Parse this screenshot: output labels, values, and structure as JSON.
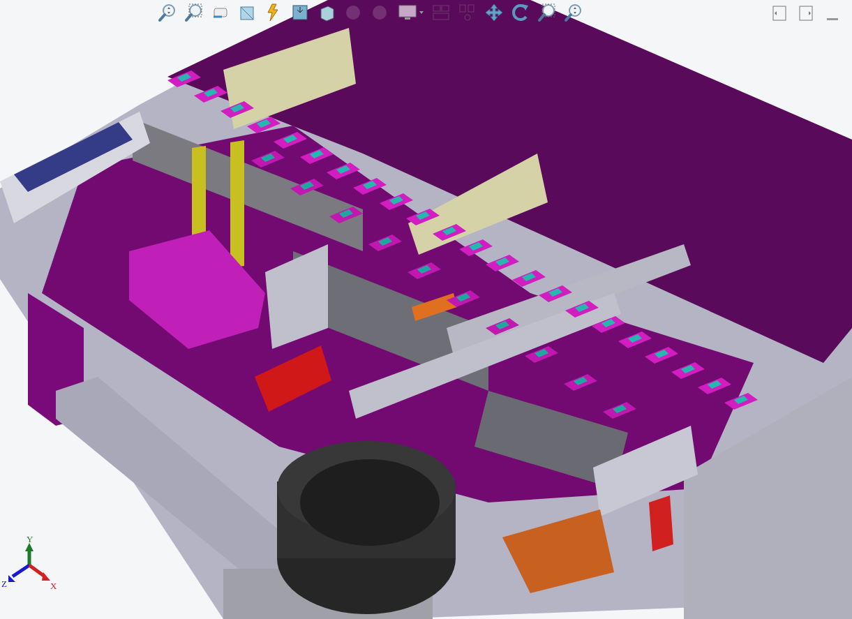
{
  "toolbar": [
    {
      "kind": "zoom-fit",
      "disabled": false
    },
    {
      "kind": "zoom-area",
      "disabled": false
    },
    {
      "kind": "previous-view",
      "disabled": false
    },
    {
      "kind": "section-view",
      "disabled": false
    },
    {
      "kind": "dynamic-annotation",
      "disabled": false
    },
    {
      "kind": "view-orientation",
      "disabled": false
    },
    {
      "kind": "display-style",
      "disabled": false
    },
    {
      "kind": "appearance",
      "disabled": true
    },
    {
      "kind": "scene",
      "disabled": true
    },
    {
      "kind": "display-pane",
      "disabled": false
    },
    {
      "kind": "view-layout",
      "disabled": true
    },
    {
      "kind": "link-views",
      "disabled": true
    },
    {
      "kind": "pan",
      "disabled": false
    },
    {
      "kind": "rotate",
      "disabled": false
    },
    {
      "kind": "zoom-area",
      "disabled": false
    },
    {
      "kind": "zoom-fit",
      "disabled": false
    }
  ],
  "window_controls": [
    {
      "kind": "left-panel"
    },
    {
      "kind": "right-panel"
    },
    {
      "kind": "minimize"
    }
  ],
  "triad": [
    {
      "label": "Y",
      "color": "#1e7a2a"
    },
    {
      "label": "Z",
      "color": "#1a1ad0"
    },
    {
      "label": "X",
      "color": "#d42020"
    }
  ]
}
